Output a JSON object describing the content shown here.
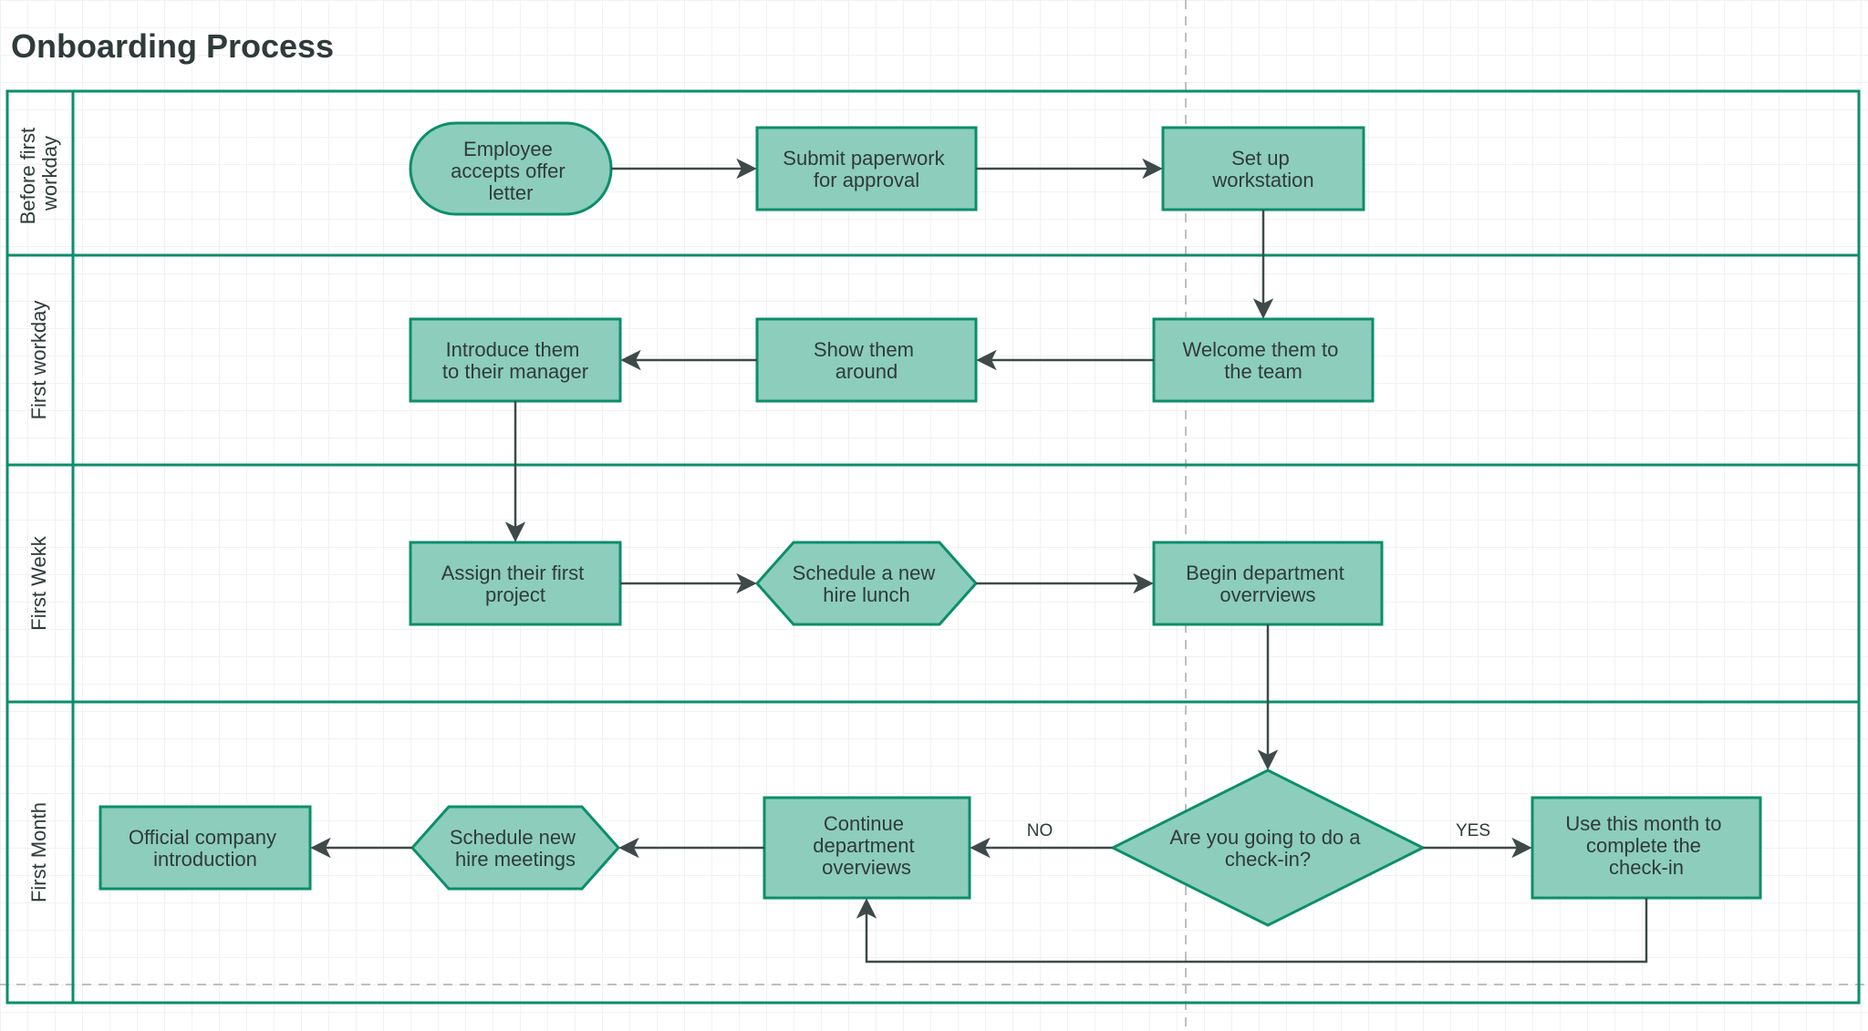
{
  "title": "Onboarding Process",
  "colors": {
    "node_fill": "#8dcdbc",
    "node_stroke": "#0b8e6b",
    "arrow": "#3e4a49",
    "text": "#2f3b3a"
  },
  "lanes": [
    {
      "id": "before",
      "label": "Before first workday"
    },
    {
      "id": "first_day",
      "label": "First workday"
    },
    {
      "id": "first_week",
      "label": "First Wekk"
    },
    {
      "id": "first_month",
      "label": "First Month"
    }
  ],
  "nodes": {
    "accept_offer": {
      "label": "Employee accepts offer letter",
      "type": "terminator",
      "lane": "before"
    },
    "submit_paperwork": {
      "label": "Submit paperwork for approval",
      "type": "process",
      "lane": "before"
    },
    "setup_workstation": {
      "label": "Set up workstation",
      "type": "process",
      "lane": "before"
    },
    "welcome_team": {
      "label": "Welcome them to the team",
      "type": "process",
      "lane": "first_day"
    },
    "show_around": {
      "label": "Show them around",
      "type": "process",
      "lane": "first_day"
    },
    "introduce_manager": {
      "label": "Introduce them to their manager",
      "type": "process",
      "lane": "first_day"
    },
    "assign_project": {
      "label": "Assign their first project",
      "type": "process",
      "lane": "first_week"
    },
    "schedule_lunch": {
      "label": "Schedule a new hire lunch",
      "type": "preparation",
      "lane": "first_week"
    },
    "begin_overviews": {
      "label": "Begin department overrviews",
      "type": "process",
      "lane": "first_week"
    },
    "checkin_decision": {
      "label": "Are you going to do a check-in?",
      "type": "decision",
      "lane": "first_month"
    },
    "complete_checkin": {
      "label": "Use this month to complete the check-in",
      "type": "process",
      "lane": "first_month"
    },
    "continue_overviews": {
      "label": "Continue department overviews",
      "type": "process",
      "lane": "first_month"
    },
    "schedule_meetings": {
      "label": "Schedule new hire meetings",
      "type": "preparation",
      "lane": "first_month"
    },
    "official_intro": {
      "label": "Official company introduction",
      "type": "process",
      "lane": "first_month"
    }
  },
  "edges": [
    {
      "from": "accept_offer",
      "to": "submit_paperwork"
    },
    {
      "from": "submit_paperwork",
      "to": "setup_workstation"
    },
    {
      "from": "setup_workstation",
      "to": "welcome_team"
    },
    {
      "from": "welcome_team",
      "to": "show_around"
    },
    {
      "from": "show_around",
      "to": "introduce_manager"
    },
    {
      "from": "introduce_manager",
      "to": "assign_project"
    },
    {
      "from": "assign_project",
      "to": "schedule_lunch"
    },
    {
      "from": "schedule_lunch",
      "to": "begin_overviews"
    },
    {
      "from": "begin_overviews",
      "to": "checkin_decision"
    },
    {
      "from": "checkin_decision",
      "to": "complete_checkin",
      "label": "YES"
    },
    {
      "from": "checkin_decision",
      "to": "continue_overviews",
      "label": "NO"
    },
    {
      "from": "complete_checkin",
      "to": "continue_overviews"
    },
    {
      "from": "continue_overviews",
      "to": "schedule_meetings"
    },
    {
      "from": "schedule_meetings",
      "to": "official_intro"
    }
  ],
  "chart_data": {
    "type": "flowchart_swimlane",
    "title": "Onboarding Process",
    "lanes": [
      "Before first workday",
      "First workday",
      "First Wekk",
      "First Month"
    ],
    "nodes": [
      {
        "id": "accept_offer",
        "label": "Employee accepts offer letter",
        "lane": 0,
        "shape": "terminator"
      },
      {
        "id": "submit_paperwork",
        "label": "Submit paperwork for approval",
        "lane": 0,
        "shape": "process"
      },
      {
        "id": "setup_workstation",
        "label": "Set up workstation",
        "lane": 0,
        "shape": "process"
      },
      {
        "id": "welcome_team",
        "label": "Welcome them to the team",
        "lane": 1,
        "shape": "process"
      },
      {
        "id": "show_around",
        "label": "Show them around",
        "lane": 1,
        "shape": "process"
      },
      {
        "id": "introduce_manager",
        "label": "Introduce them to their manager",
        "lane": 1,
        "shape": "process"
      },
      {
        "id": "assign_project",
        "label": "Assign their first project",
        "lane": 2,
        "shape": "process"
      },
      {
        "id": "schedule_lunch",
        "label": "Schedule a new hire lunch",
        "lane": 2,
        "shape": "preparation"
      },
      {
        "id": "begin_overviews",
        "label": "Begin department overrviews",
        "lane": 2,
        "shape": "process"
      },
      {
        "id": "checkin_decision",
        "label": "Are you going to do a check-in?",
        "lane": 3,
        "shape": "decision"
      },
      {
        "id": "complete_checkin",
        "label": "Use this month to complete the check-in",
        "lane": 3,
        "shape": "process"
      },
      {
        "id": "continue_overviews",
        "label": "Continue department overviews",
        "lane": 3,
        "shape": "process"
      },
      {
        "id": "schedule_meetings",
        "label": "Schedule new hire meetings",
        "lane": 3,
        "shape": "preparation"
      },
      {
        "id": "official_intro",
        "label": "Official company introduction",
        "lane": 3,
        "shape": "process"
      }
    ],
    "edges": [
      {
        "from": "accept_offer",
        "to": "submit_paperwork"
      },
      {
        "from": "submit_paperwork",
        "to": "setup_workstation"
      },
      {
        "from": "setup_workstation",
        "to": "welcome_team"
      },
      {
        "from": "welcome_team",
        "to": "show_around"
      },
      {
        "from": "show_around",
        "to": "introduce_manager"
      },
      {
        "from": "introduce_manager",
        "to": "assign_project"
      },
      {
        "from": "assign_project",
        "to": "schedule_lunch"
      },
      {
        "from": "schedule_lunch",
        "to": "begin_overviews"
      },
      {
        "from": "begin_overviews",
        "to": "checkin_decision"
      },
      {
        "from": "checkin_decision",
        "to": "complete_checkin",
        "label": "YES"
      },
      {
        "from": "checkin_decision",
        "to": "continue_overviews",
        "label": "NO"
      },
      {
        "from": "complete_checkin",
        "to": "continue_overviews"
      },
      {
        "from": "continue_overviews",
        "to": "schedule_meetings"
      },
      {
        "from": "schedule_meetings",
        "to": "official_intro"
      }
    ]
  }
}
